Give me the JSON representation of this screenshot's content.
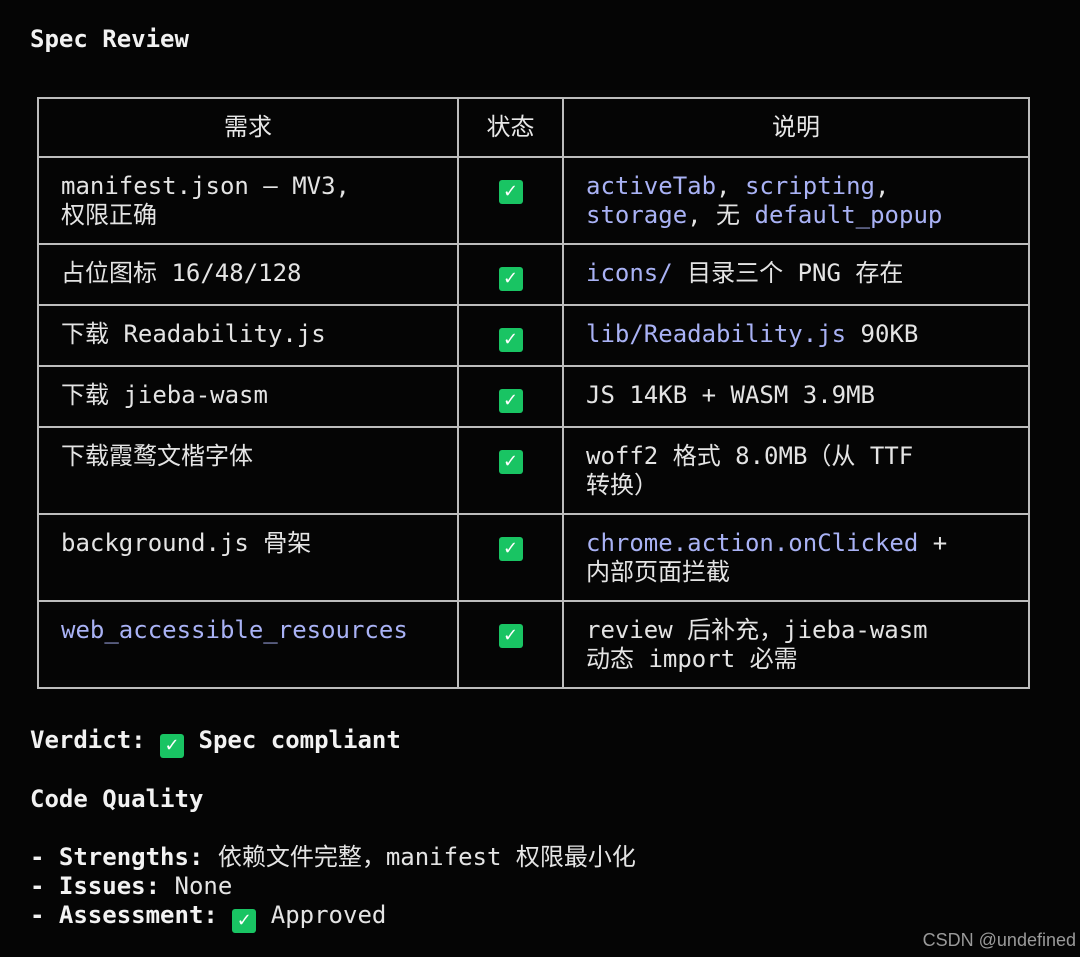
{
  "spec_review": {
    "title": "Spec Review",
    "headers": {
      "requirement": "需求",
      "status": "状态",
      "description": "说明"
    },
    "rows": [
      {
        "req_line1": "manifest.json — MV3,",
        "req_line2": "权限正确",
        "desc_perm1": "activeTab",
        "desc_sep1": ", ",
        "desc_perm2": "scripting",
        "desc_sep2": ",",
        "desc_perm3": "storage",
        "desc_sep3": ", 无 ",
        "desc_perm4": "default_popup"
      },
      {
        "req": "占位图标 16/48/128",
        "desc_code": "icons/",
        "desc_text": " 目录三个 PNG 存在"
      },
      {
        "req": "下载 Readability.js",
        "desc_code": "lib/Readability.js",
        "desc_text": " 90KB"
      },
      {
        "req": "下载 jieba-wasm",
        "desc": "JS 14KB + WASM 3.9MB"
      },
      {
        "req": "下载霞鹜文楷字体",
        "desc_line1": "woff2 格式 8.0MB（从 TTF",
        "desc_line2": "转换）"
      },
      {
        "req": "background.js 骨架",
        "desc_code": "chrome.action.onClicked",
        "desc_text": " +",
        "desc_line2": "内部页面拦截"
      },
      {
        "req_code": "web_accessible_resources",
        "desc_line1": "review 后补充，jieba-wasm",
        "desc_line2": "动态 import 必需"
      }
    ]
  },
  "verdict": {
    "label": "Verdict: ",
    "value": " Spec compliant"
  },
  "code_quality": {
    "title": "Code Quality",
    "strengths_label": "- Strengths:",
    "strengths_value": " 依赖文件完整，manifest 权限最小化",
    "issues_label": "- Issues:",
    "issues_value": " None",
    "assessment_label": "- Assessment:",
    "assessment_value": " Approved"
  },
  "watermark": "CSDN @undefined",
  "colors": {
    "background": "#050505",
    "text": "#e4e4e4",
    "code": "#a9b2f5",
    "check": "#19c463",
    "border": "#bdbdbd"
  },
  "icons": {
    "status": "check-box-icon"
  }
}
